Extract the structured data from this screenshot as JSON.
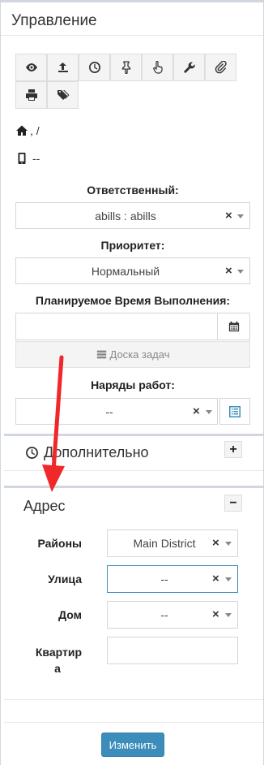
{
  "header": {
    "title": "Управление"
  },
  "toolbar": {
    "icons": [
      "eye-icon",
      "upload-icon",
      "clock-icon",
      "pin-icon",
      "hand-pointer-icon",
      "wrench-icon",
      "paperclip-icon",
      "print-icon",
      "tags-icon"
    ]
  },
  "info": {
    "home_path": ", /",
    "phone": "--"
  },
  "responsible": {
    "label": "Ответственный:",
    "value": "abills : abills"
  },
  "priority": {
    "label": "Приоритет:",
    "value": "Нормальный"
  },
  "planned": {
    "label": "Планируемое Время Выполнения:",
    "value": "",
    "board_label": "Доска задач"
  },
  "work_orders": {
    "label": "Наряды работ:",
    "value": "--"
  },
  "extra_box": {
    "title": "Дополнительно",
    "toggle": "+"
  },
  "address_box": {
    "title": "Адрес",
    "toggle": "−",
    "district": {
      "label": "Районы",
      "value": "Main District"
    },
    "street": {
      "label": "Улица",
      "value": "--"
    },
    "house": {
      "label": "Дом",
      "value": "--"
    },
    "apartment": {
      "label": "Квартир\nа",
      "label_line1": "Квартир",
      "label_line2": "а",
      "value": ""
    }
  },
  "submit": {
    "label": "Изменить"
  },
  "colors": {
    "accent": "#3c8dbc",
    "annotation_arrow": "#f0282a"
  }
}
